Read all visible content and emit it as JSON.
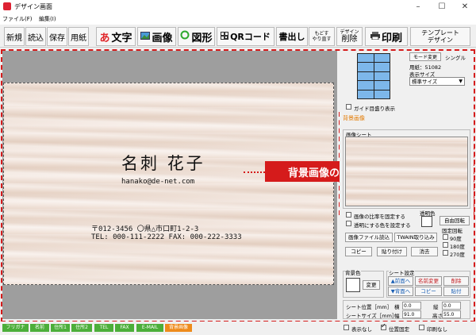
{
  "window": {
    "title": "デザイン画面",
    "minimize": "–",
    "maximize": "☐",
    "close": "✕"
  },
  "menu": [
    "ファイル(F)",
    "編集(I)"
  ],
  "toolbar": {
    "new": "新規",
    "open": "読込",
    "save": "保存",
    "paper": "用紙",
    "text_icon": "あ",
    "text": "文字",
    "image": "画像",
    "shape": "図形",
    "qr": "QRコード",
    "export": "書出し",
    "undo_line1": "もどす",
    "undo_line2": "やり直す",
    "delete_small": "デザイン",
    "delete": "削除",
    "print": "印刷",
    "template_line1": "テンプレート",
    "template_line2": "デザイン"
  },
  "card": {
    "name": "名刺 花子",
    "email": "hanako@de-net.com",
    "address": "〒012-3456 〇県△市口町1-2-3",
    "phone_fax": "TEL: 000-111-2222 FAX: 000-222-3333"
  },
  "callout": "背景画像の差し替えができました",
  "panel": {
    "mode_button": "モード変更",
    "mode_value": "シングル",
    "paper_label": "用紙：51082",
    "display_size_label": "表示サイズ",
    "display_size_value": "標準サイズ",
    "guide_checkbox": "ガイド目盛り表示",
    "bg_section": "背景画像",
    "sheet_label": "画像シート",
    "keep_ratio": "画像の比率を固定する",
    "transparent_color": "透明にする色を設定する",
    "transparent_label": "透明色",
    "free_rotate": "自由回転",
    "load_image": "画像ファイル読込",
    "twain": "TWAIN取り込み",
    "copy": "コピー",
    "paste": "貼り付け",
    "erase": "消去",
    "fixed_rotate": "固定回転",
    "rot90": "90度",
    "rot180": "180度",
    "rot270": "270度",
    "bg_color": "背景色",
    "change": "変更",
    "sheet_settings": "シート設定",
    "to_front": "▲前面へ",
    "rename": "名前変更",
    "delete": "削除",
    "to_back": "▼背面へ",
    "sheet_copy": "コピー",
    "sheet_paste": "貼付",
    "sheet_pos": "シート位置［mm］",
    "horizontal": "横",
    "vertical": "縦",
    "sheet_size": "シートサイズ［mm］",
    "width": "幅",
    "height": "高さ",
    "pos_x": "0.0",
    "pos_y": "0.0",
    "size_w": "91.0",
    "size_h": "55.0",
    "hide": "表示なし",
    "fix_position": "位置固定",
    "no_print": "印刷なし"
  },
  "field_tabs": [
    "フリガナ",
    "名前",
    "住所1",
    "住所2",
    "TEL",
    "FAX",
    "E-MAIL",
    "背景画像"
  ],
  "colors": {
    "accent_red": "#d51b1b",
    "tab_green": "#4cae3a",
    "tab_active": "#ee8b1c"
  }
}
